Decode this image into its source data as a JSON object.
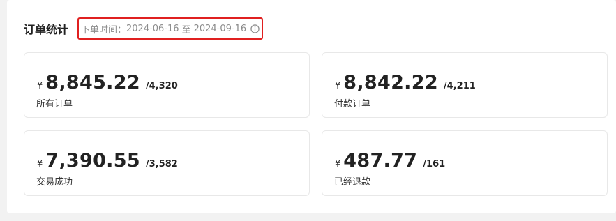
{
  "section": {
    "title": "订单统计",
    "range_label": "下单时间：",
    "range_start": "2024-06-16",
    "range_sep": "至",
    "range_end": "2024-09-16",
    "info_icon": "info-circle-icon"
  },
  "cards": [
    {
      "currency": "¥",
      "amount": "8,845.22",
      "count": "/4,320",
      "label": "所有订单"
    },
    {
      "currency": "¥",
      "amount": "8,842.22",
      "count": "/4,211",
      "label": "付款订单"
    },
    {
      "currency": "¥",
      "amount": "7,390.55",
      "count": "/3,582",
      "label": "交易成功"
    },
    {
      "currency": "¥",
      "amount": "487.77",
      "count": "/161",
      "label": "已经退款"
    }
  ],
  "colors": {
    "highlight_border": "#e02020",
    "muted_text": "#8c8c8c",
    "card_border": "#e8e8e8"
  }
}
